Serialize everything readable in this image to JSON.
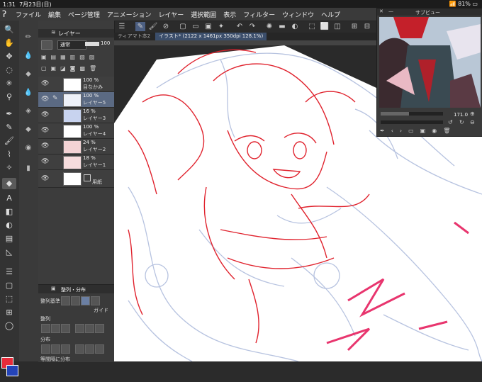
{
  "status_bar": {
    "time": "1:31",
    "date": "7月23日(日)",
    "battery": "81%"
  },
  "menu": {
    "items": [
      "ファイル",
      "編集",
      "ページ管理",
      "アニメーション",
      "レイヤー",
      "選択範囲",
      "表示",
      "フィルター",
      "ウィンドウ",
      "ヘルプ"
    ]
  },
  "layer_panel": {
    "tab_label": "レイヤー",
    "blend_mode": "通常",
    "opacity": "100",
    "layers": [
      {
        "pct": "100 %",
        "name": "目なかみ"
      },
      {
        "pct": "100 %",
        "name": "レイヤー5"
      },
      {
        "pct": "16 %",
        "name": "レイヤー3"
      },
      {
        "pct": "100 %",
        "name": "レイヤー4"
      },
      {
        "pct": "24 %",
        "name": "レイヤー2"
      },
      {
        "pct": "18 %",
        "name": "レイヤー1"
      },
      {
        "pct": "",
        "name": "用紙"
      }
    ]
  },
  "align_panel": {
    "tab_label": "整列・分布",
    "criteria_label": "整列基準",
    "guide_label": "ガイド",
    "align_label": "整列",
    "distribute_label": "分布",
    "equal_label": "等間隔に分布"
  },
  "doc_tabs": [
    "ティアマト本2",
    "イラスト* (2122 x 1461px 350dpi 128.1%)"
  ],
  "navigator": {
    "title": "サブビュー",
    "zoom": "171.0"
  },
  "colors": {
    "main": "#e62b3a",
    "sub": "#2444b8",
    "line_red": "#e0232e",
    "line_blue": "#b7c3e0",
    "canvas_bg": "#ffffff"
  }
}
